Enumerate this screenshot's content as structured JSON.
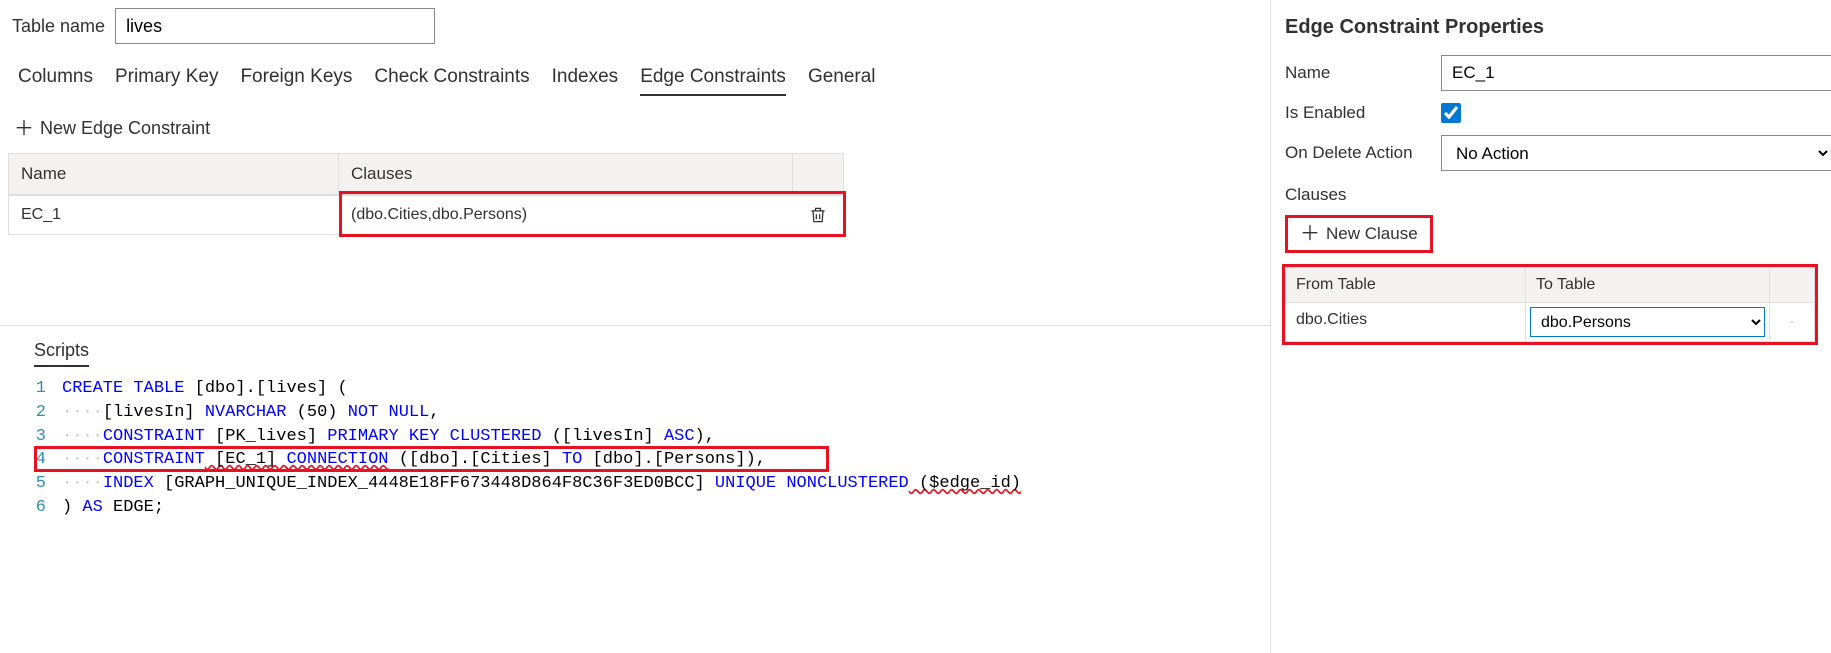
{
  "table_name_label": "Table name",
  "table_name_value": "lives",
  "tabs": {
    "columns": "Columns",
    "primary_key": "Primary Key",
    "foreign_keys": "Foreign Keys",
    "check_constraints": "Check Constraints",
    "indexes": "Indexes",
    "edge_constraints": "Edge Constraints",
    "general": "General"
  },
  "new_edge_constraint_label": "New Edge Constraint",
  "ec_table": {
    "col_name": "Name",
    "col_clauses": "Clauses",
    "rows": [
      {
        "name": "EC_1",
        "clauses": "(dbo.Cities,dbo.Persons)"
      }
    ]
  },
  "scripts_title": "Scripts",
  "code": {
    "l1": {
      "n": "1",
      "a": "CREATE TABLE",
      "b": " [dbo].[lives] ("
    },
    "l2": {
      "n": "2",
      "dots": "····",
      "a": "[livesIn] ",
      "b": "NVARCHAR",
      "c": " (",
      "d": "50",
      "e": ") ",
      "f": "NOT NULL",
      "g": ","
    },
    "l3": {
      "n": "3",
      "dots": "····",
      "a": "CONSTRAINT",
      "b": " [PK_lives] ",
      "c": "PRIMARY KEY CLUSTERED",
      "d": " ([livesIn] ",
      "e": "ASC",
      "f": "),"
    },
    "l4": {
      "n": "4",
      "dots": "····",
      "a": "CONSTRAINT",
      "b": " [EC_1] ",
      "c": "CONNECTION",
      "d": " ([dbo].[Cities] ",
      "e": "TO",
      "f": " [dbo].[Persons]),"
    },
    "l5": {
      "n": "5",
      "dots": "····",
      "a": "INDEX",
      "b": " [GRAPH_UNIQUE_INDEX_4448E18FF673448D864F8C36F3ED0BCC] ",
      "c": "UNIQUE NONCLUSTERED",
      "d": " ($edge_id)"
    },
    "l6": {
      "n": "6",
      "a": ") ",
      "b": "AS",
      "c": " EDGE;"
    }
  },
  "right_panel": {
    "title": "Edge Constraint Properties",
    "name_label": "Name",
    "name_value": "EC_1",
    "enabled_label": "Is Enabled",
    "delete_label": "On Delete Action",
    "delete_value": "No Action",
    "clauses_label": "Clauses",
    "new_clause_label": "New Clause",
    "clause_table": {
      "from_header": "From Table",
      "to_header": "To Table",
      "from_value": "dbo.Cities",
      "to_value": "dbo.Persons"
    }
  }
}
